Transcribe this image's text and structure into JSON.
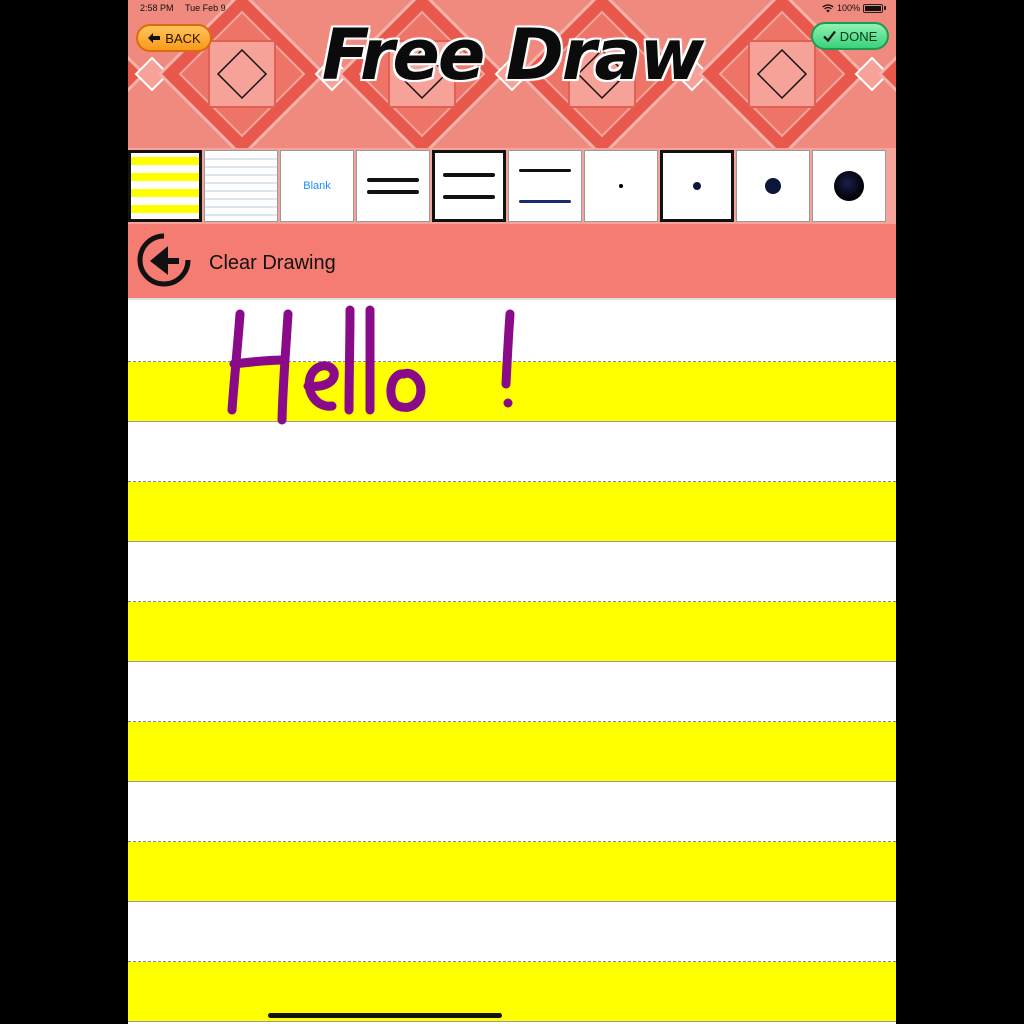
{
  "status_bar": {
    "time": "2:58 PM",
    "date": "Tue Feb 9",
    "battery": "100%",
    "wifi_icon": "wifi-icon",
    "battery_icon": "battery-icon"
  },
  "header": {
    "title": "Free Draw",
    "back_label": "BACK",
    "done_label": "DONE",
    "back_icon": "arrow-left-icon",
    "done_icon": "checkmark-icon"
  },
  "options": [
    {
      "name": "yellow-lined-paper",
      "label": ""
    },
    {
      "name": "blue-lined-paper",
      "label": ""
    },
    {
      "name": "blank-paper",
      "label": "Blank"
    },
    {
      "name": "line-size-small",
      "label": ""
    },
    {
      "name": "line-size-medium",
      "label": ""
    },
    {
      "name": "line-size-large",
      "label": ""
    },
    {
      "name": "brush-tiny",
      "label": ""
    },
    {
      "name": "brush-small",
      "label": ""
    },
    {
      "name": "brush-medium",
      "label": ""
    },
    {
      "name": "brush-large",
      "label": ""
    }
  ],
  "clear": {
    "label": "Clear Drawing",
    "icon": "undo-circle-icon"
  },
  "drawing": {
    "text": "Hello!",
    "ink_color": "#8a0b8a"
  },
  "colors": {
    "header_bg": "#f08a7e",
    "toolbar_bg": "#f5a49b",
    "clear_bg": "#f57c73",
    "paper_yellow": "#ffff00",
    "paper_white": "#ffffff"
  }
}
